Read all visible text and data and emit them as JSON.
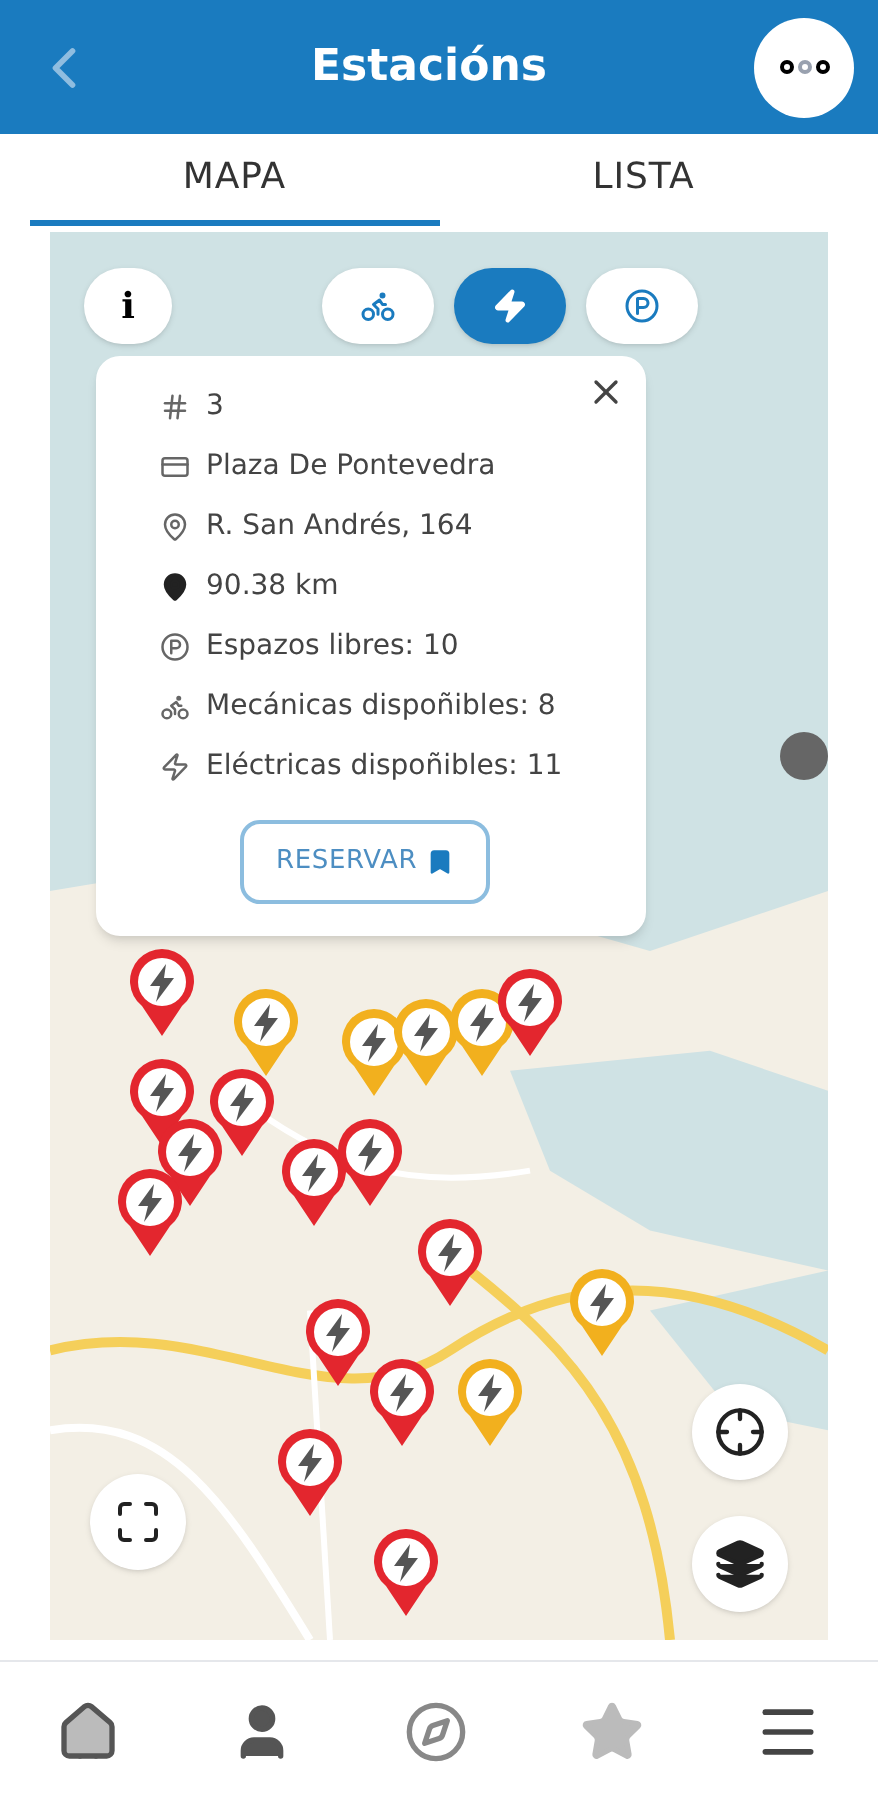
{
  "header": {
    "title": "Estacións"
  },
  "tabs": [
    {
      "label": "MAPA",
      "selected": true
    },
    {
      "label": "LISTA",
      "selected": false
    }
  ],
  "info_button": "i",
  "filters": [
    {
      "kind": "bike",
      "selected": false
    },
    {
      "kind": "electric",
      "selected": true
    },
    {
      "kind": "parking",
      "selected": false
    }
  ],
  "popup": {
    "fields": [
      {
        "kind": "number",
        "text": "3"
      },
      {
        "kind": "name",
        "text": "Plaza De Pontevedra"
      },
      {
        "kind": "address",
        "text": "R. San Andrés, 164"
      },
      {
        "kind": "distance",
        "text": "90.38 km"
      },
      {
        "kind": "parking",
        "text": "Espazos libres: 10"
      },
      {
        "kind": "mechanical",
        "text": "Mecánicas dispoñibles: 8"
      },
      {
        "kind": "electric",
        "text": "Eléctricas dispoñibles: 11"
      }
    ],
    "button": "RESERVAR"
  },
  "markers": [
    {
      "color": "#e3262e"
    },
    {
      "color": "#f2b01e"
    },
    {
      "color": "#f2b01e"
    },
    {
      "color": "#f2b01e"
    },
    {
      "color": "#f2b01e"
    },
    {
      "color": "#e3262e"
    },
    {
      "color": "#e3262e"
    },
    {
      "color": "#e3262e"
    },
    {
      "color": "#e3262e"
    },
    {
      "color": "#e3262e"
    },
    {
      "color": "#e3262e"
    },
    {
      "color": "#e3262e"
    },
    {
      "color": "#e3262e"
    },
    {
      "color": "#f2b01e"
    },
    {
      "color": "#e3262e"
    },
    {
      "color": "#e3262e"
    },
    {
      "color": "#f2b01e"
    },
    {
      "color": "#e3262e"
    },
    {
      "color": "#e3262e"
    }
  ]
}
